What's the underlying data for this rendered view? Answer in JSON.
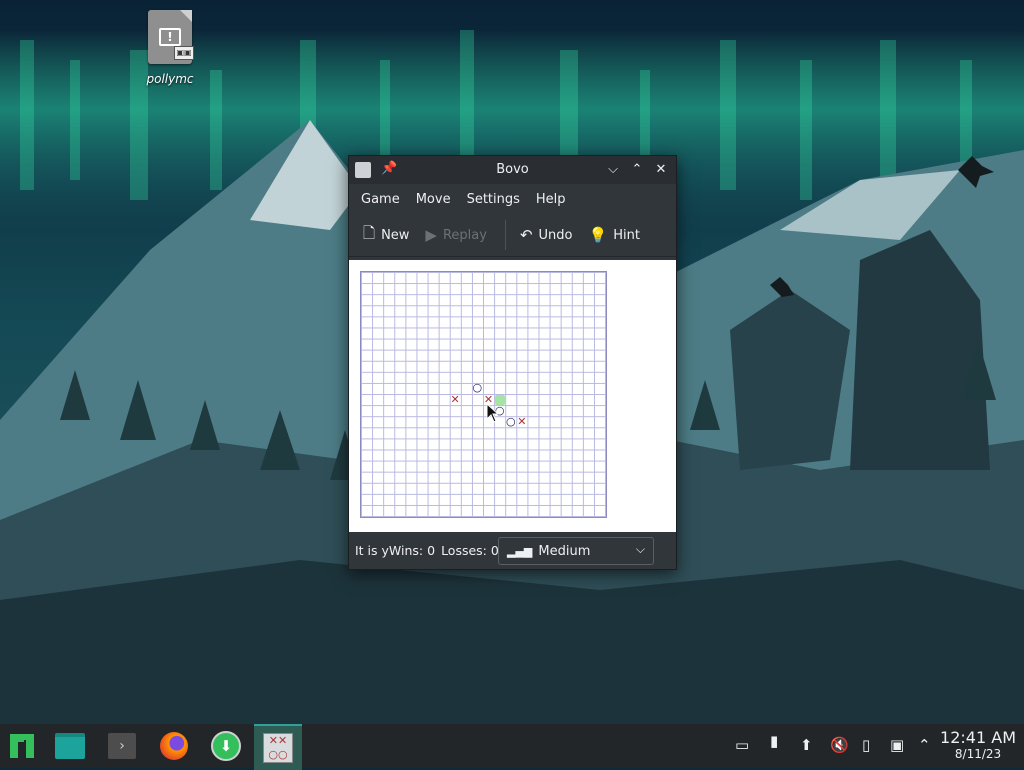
{
  "desktop": {
    "icons": [
      {
        "label": "pollymc"
      }
    ]
  },
  "window": {
    "title": "Bovo",
    "menu": [
      "Game",
      "Move",
      "Settings",
      "Help"
    ],
    "toolbar": {
      "new_label": "New",
      "replay_label": "Replay",
      "undo_label": "Undo",
      "hint_label": "Hint"
    },
    "status": {
      "text": "It is y",
      "wins": "Wins: 0",
      "losses": "Losses: 0",
      "difficulty": "Medium"
    },
    "board": {
      "grid_size": 22,
      "pieces": [
        {
          "type": "O",
          "col": 10,
          "row": 10
        },
        {
          "type": "X",
          "col": 8,
          "row": 11
        },
        {
          "type": "X",
          "col": 11,
          "row": 11
        },
        {
          "type": "O",
          "col": 12,
          "row": 12
        },
        {
          "type": "O",
          "col": 13,
          "row": 13
        },
        {
          "type": "X",
          "col": 14,
          "row": 13
        }
      ],
      "last_move": {
        "col": 12,
        "row": 11
      }
    }
  },
  "taskbar": {
    "apps": [
      "app-launcher",
      "file-manager",
      "terminal",
      "firefox",
      "software-updater",
      "bovo"
    ],
    "clock": {
      "time": "12:41 AM",
      "date": "8/11/23"
    }
  }
}
